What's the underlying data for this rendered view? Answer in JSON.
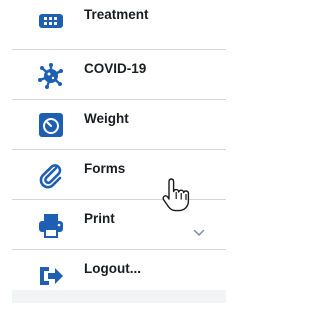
{
  "menu": {
    "items": [
      {
        "label": "Treatment",
        "icon": "pill-pack-icon"
      },
      {
        "label": "COVID-19",
        "icon": "virus-icon"
      },
      {
        "label": "Weight",
        "icon": "scale-icon"
      },
      {
        "label": "Forms",
        "icon": "paperclip-icon"
      },
      {
        "label": "Print",
        "icon": "printer-icon"
      },
      {
        "label": "Logout...",
        "icon": "logout-icon"
      }
    ]
  },
  "colors": {
    "accent": "#1f5fb3",
    "text": "#1a1d21",
    "divider": "#d4d6da",
    "footer": "#f3f4f5"
  }
}
